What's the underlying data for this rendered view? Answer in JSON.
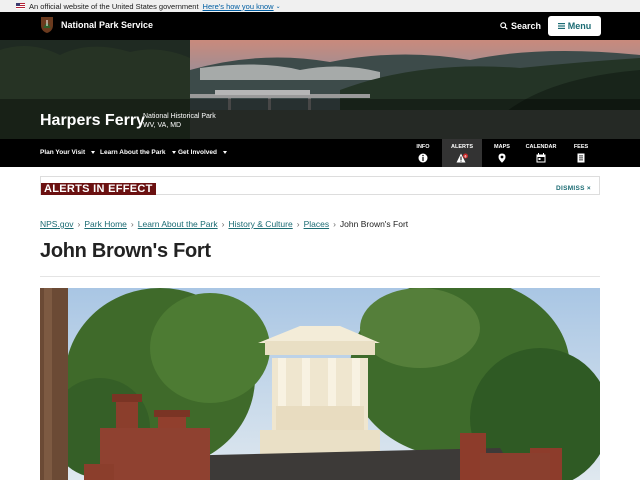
{
  "gov_banner": {
    "text": "An official website of the United States government",
    "link": "Here's how you know"
  },
  "header": {
    "agency": "National Park Service",
    "search": "Search",
    "menu": "Menu"
  },
  "park": {
    "name": "Harpers Ferry",
    "designation": "National Historical Park",
    "states": "WV, VA, MD"
  },
  "park_nav": {
    "items": [
      "Plan Your Visit",
      "Learn About the Park",
      "Get Involved"
    ],
    "quick_links": [
      {
        "label": "INFO",
        "icon": "info-icon"
      },
      {
        "label": "ALERTS",
        "icon": "alert-icon",
        "count": "6"
      },
      {
        "label": "MAPS",
        "icon": "map-pin-icon"
      },
      {
        "label": "CALENDAR",
        "icon": "calendar-icon"
      },
      {
        "label": "FEES",
        "icon": "fees-icon"
      }
    ]
  },
  "alerts": {
    "title": "ALERTS IN EFFECT",
    "dismiss": "DISMISS ×"
  },
  "breadcrumb": {
    "items": [
      "NPS.gov",
      "Park Home",
      "Learn About the Park",
      "History & Culture",
      "Places"
    ],
    "current": "John Brown's Fort"
  },
  "page": {
    "title": "John Brown's Fort"
  },
  "colors": {
    "header_bg": "#000000",
    "link": "#1b6b73",
    "alert": "#6b1111"
  }
}
